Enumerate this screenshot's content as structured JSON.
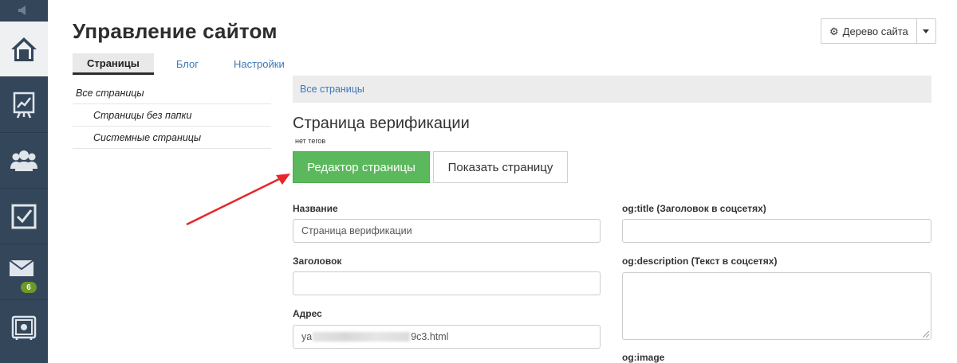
{
  "header": {
    "title": "Управление сайтом",
    "tree_button": "Дерево сайта"
  },
  "tabs": [
    {
      "label": "Страницы",
      "active": true
    },
    {
      "label": "Блог",
      "active": false
    },
    {
      "label": "Настройки",
      "active": false
    }
  ],
  "sidebar": {
    "items": [
      {
        "icon": "home-icon",
        "active": true
      },
      {
        "icon": "chart-board-icon"
      },
      {
        "icon": "users-icon"
      },
      {
        "icon": "checkbox-icon"
      },
      {
        "icon": "mail-icon",
        "badge": "6"
      },
      {
        "icon": "safe-icon"
      }
    ]
  },
  "tree": {
    "items": [
      "Все страницы",
      "Страницы без папки",
      "Системные страницы"
    ]
  },
  "breadcrumb": "Все страницы",
  "page": {
    "title": "Страница верификации",
    "tags": "нет тегов",
    "editor_button": "Редактор страницы",
    "show_button": "Показать страницу"
  },
  "form": {
    "name_label": "Название",
    "name_value": "Страница верификации",
    "heading_label": "Заголовок",
    "heading_value": "",
    "address_label": "Адрес",
    "address_prefix": "ya",
    "address_suffix": "9c3.html",
    "og_title_label": "og:title (Заголовок в соцсетях)",
    "og_desc_label": "og:description (Текст в соцсетях)",
    "og_image_label": "og:image"
  },
  "colors": {
    "rail": "#34475a",
    "accent_green": "#5cb85c",
    "link": "#3a78b8",
    "arrow": "#e8262a"
  }
}
